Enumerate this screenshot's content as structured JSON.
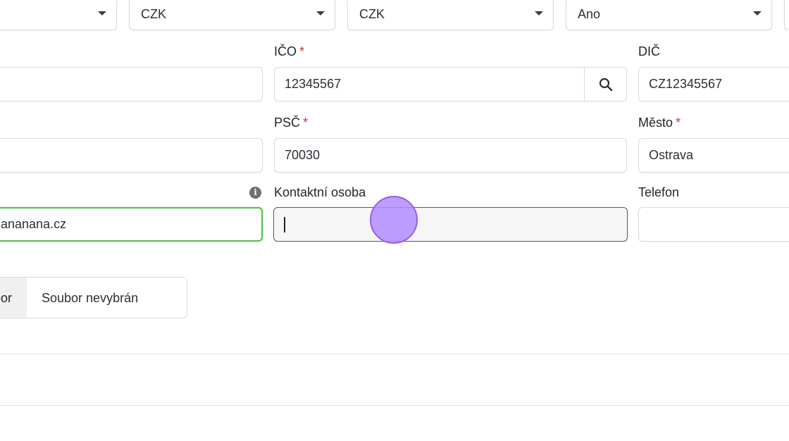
{
  "selects": [
    {
      "value": ""
    },
    {
      "value": "CZK"
    },
    {
      "value": "CZK"
    },
    {
      "value": "Ano"
    }
  ],
  "ico": {
    "label": "IČO",
    "required": "*",
    "value": "12345567"
  },
  "dic": {
    "label": "DIČ",
    "value": "CZ12345567"
  },
  "psc": {
    "label": "PSČ",
    "required": "*",
    "value": "70030"
  },
  "mesto": {
    "label": "Město",
    "required": "*",
    "value": "Ostrava"
  },
  "web": {
    "value": "ananana.cz",
    "info_icon": "i"
  },
  "kontakt": {
    "label": "Kontaktní osoba",
    "value": ""
  },
  "telefon": {
    "label": "Telefon",
    "value": ""
  },
  "file": {
    "button_label": "Vybrat soubor",
    "status": "Soubor nevybrán"
  }
}
